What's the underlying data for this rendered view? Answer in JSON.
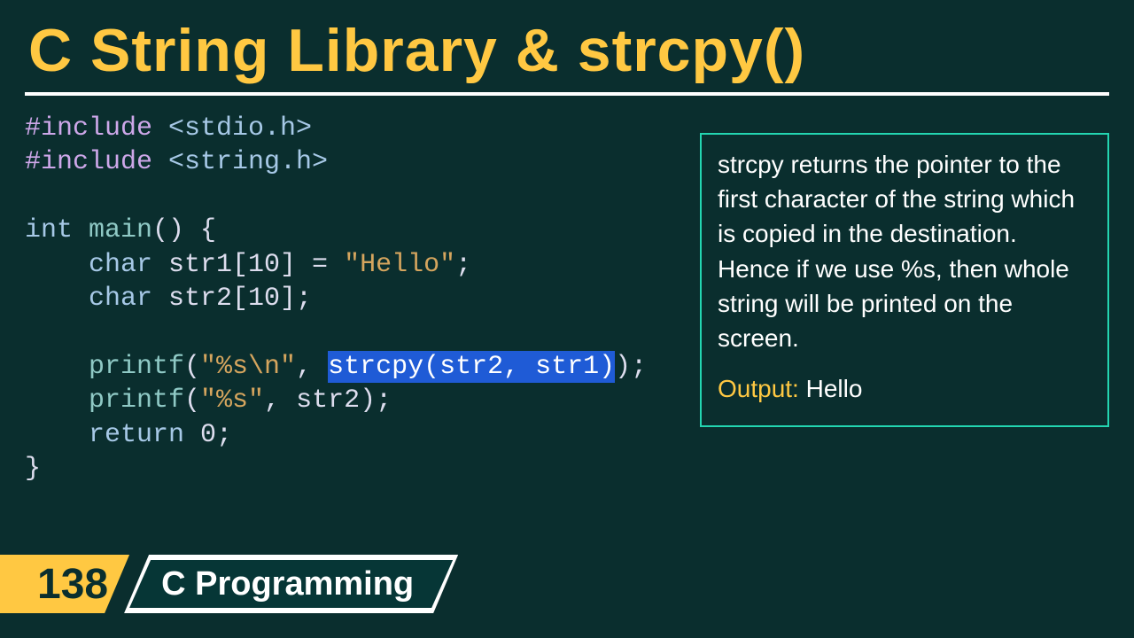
{
  "title": "C String Library & strcpy()",
  "code": {
    "l1a": "#include",
    "l1b": " <stdio.h>",
    "l2a": "#include",
    "l2b": " <string.h>",
    "l4a": "int",
    "l4b": " main",
    "l4c": "() {",
    "l5a": "    char",
    "l5b": " str1[10] = ",
    "l5c": "\"Hello\"",
    "l5d": ";",
    "l6a": "    char",
    "l6b": " str2[10];",
    "l8a": "    printf",
    "l8b": "(",
    "l8c": "\"%s\\n\"",
    "l8d": ", ",
    "l8e": "strcpy(str2, str1)",
    "l8f": ");",
    "l9a": "    printf",
    "l9b": "(",
    "l9c": "\"%s\"",
    "l9d": ", str2);",
    "l10a": "    return",
    "l10b": " 0;",
    "l11": "}"
  },
  "explain": {
    "text": "strcpy returns the pointer to the first character of the string which is copied in the destination.\nHence if we use %s,  then whole string will be printed on the screen.",
    "out_label": "Output:",
    "out_value": "  Hello"
  },
  "footer": {
    "number": "138",
    "topic": "C Programming"
  }
}
